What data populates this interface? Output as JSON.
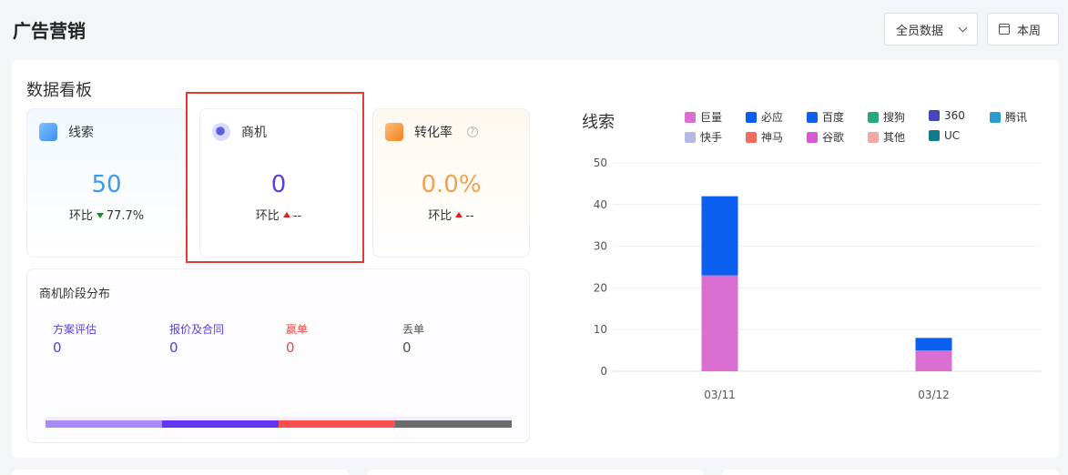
{
  "header": {
    "title": "广告营销",
    "scope_select": "全员数据",
    "period_button": "本周"
  },
  "dashboard": {
    "title": "数据看板",
    "cards": [
      {
        "id": "leads",
        "label": "线索",
        "value": "50",
        "compare_label": "环比",
        "compare_value": "77.7%",
        "trend": "down",
        "value_color": "#3b9bf0"
      },
      {
        "id": "opportunities",
        "label": "商机",
        "value": "0",
        "compare_label": "环比",
        "compare_value": "--",
        "trend": "up",
        "value_color": "#5a3ee8"
      },
      {
        "id": "conversion",
        "label": "转化率",
        "value": "0.0%",
        "compare_label": "环比",
        "compare_value": "--",
        "trend": "up",
        "value_color": "#f5a04a"
      }
    ],
    "stages": {
      "title": "商机阶段分布",
      "items": [
        {
          "label": "方案评估",
          "value": "0",
          "color": "#5a3ee8"
        },
        {
          "label": "报价及合同",
          "value": "0",
          "color": "#5a3ee8"
        },
        {
          "label": "赢单",
          "value": "0",
          "color": "#e84a4a"
        },
        {
          "label": "丢单",
          "value": "0",
          "color": "#555555"
        }
      ],
      "bar_colors": [
        "#a98bf5",
        "#6236f0",
        "#ff4d4f",
        "#6b6b6b"
      ]
    }
  },
  "chart_data": {
    "type": "bar",
    "title": "线索",
    "stacked": true,
    "categories": [
      "03/11",
      "03/12"
    ],
    "ylim": [
      0,
      50
    ],
    "yticks": [
      0,
      10,
      20,
      30,
      40,
      50
    ],
    "grid": true,
    "legend_position": "top-right",
    "series": [
      {
        "name": "巨量",
        "color": "#da6fd1",
        "values": [
          23,
          5
        ]
      },
      {
        "name": "必应",
        "color": "#0a5ff0",
        "values": [
          19,
          3
        ]
      },
      {
        "name": "百度",
        "color": "#0f5fee",
        "values": [
          0,
          0
        ]
      },
      {
        "name": "搜狗",
        "color": "#27a87a",
        "values": [
          0,
          0
        ]
      },
      {
        "name": "360",
        "color": "#4448b8",
        "values": [
          0,
          0
        ]
      },
      {
        "name": "腾讯",
        "color": "#2b9bd0",
        "values": [
          0,
          0
        ]
      },
      {
        "name": "快手",
        "color": "#b8b8e6",
        "values": [
          0,
          0
        ]
      },
      {
        "name": "神马",
        "color": "#f56b5b",
        "values": [
          0,
          0
        ]
      },
      {
        "name": "谷歌",
        "color": "#d75bd0",
        "values": [
          0,
          0
        ]
      },
      {
        "name": "其他",
        "color": "#f4a8a4",
        "values": [
          0,
          0
        ]
      },
      {
        "name": "UC",
        "color": "#117a8b",
        "values": [
          0,
          0
        ]
      }
    ]
  }
}
